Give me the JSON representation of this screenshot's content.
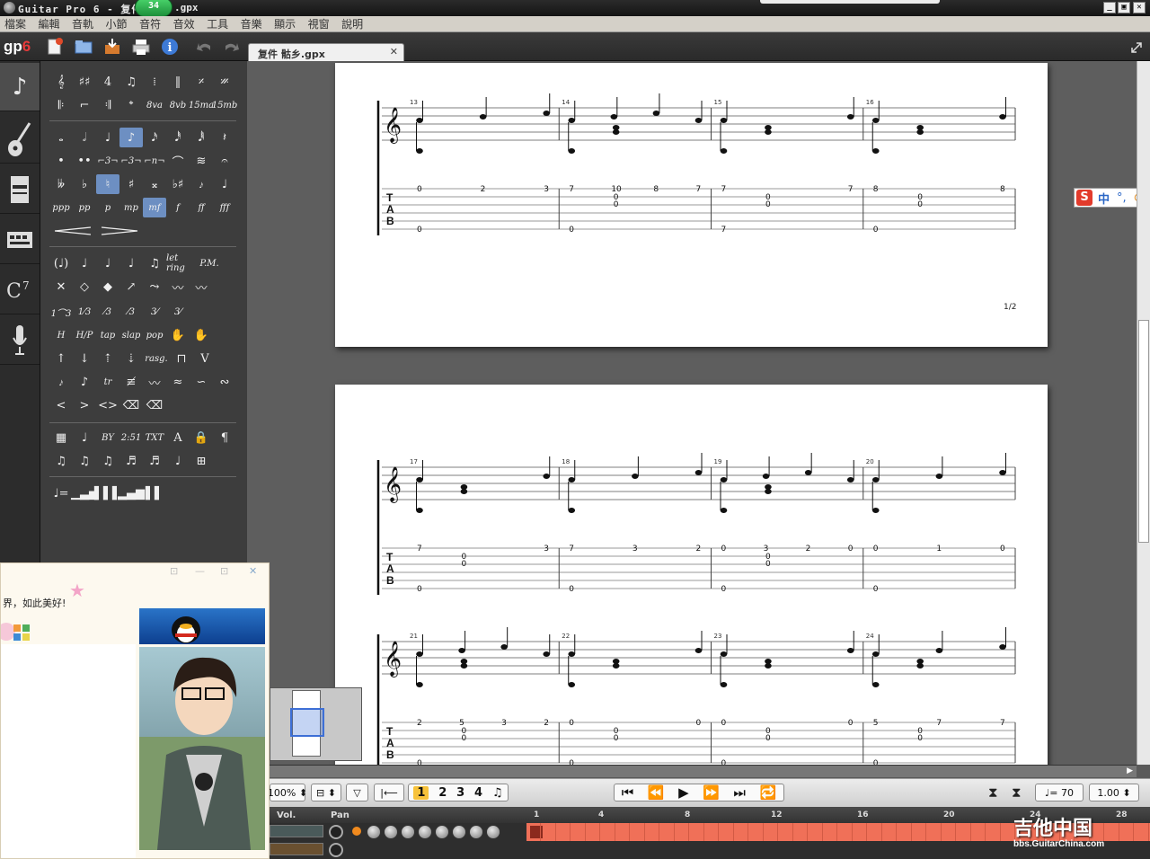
{
  "window": {
    "title_prefix": "Guitar Pro 6 - 复件",
    "title_suffix": ".gpx",
    "notification_badge": "34",
    "controls": [
      "_",
      "▣",
      "✕"
    ]
  },
  "menu": [
    "檔案",
    "編輯",
    "音軌",
    "小節",
    "音符",
    "音效",
    "工具",
    "音樂",
    "顯示",
    "視窗",
    "說明"
  ],
  "toolbar": {
    "logo_text": "gp",
    "logo_suffix": "6"
  },
  "document": {
    "tab_label": "复件 骷乡.gpx",
    "tab_close": "✕",
    "page_number": "1/2"
  },
  "score": {
    "systems": [
      {
        "bars": [
          {
            "num": "13",
            "tab_top": [
              "0",
              "2",
              "3"
            ],
            "tab_mid": [],
            "tab_bottom": [
              "0"
            ]
          },
          {
            "num": "14",
            "tab_top": [
              "7",
              "10",
              "8",
              "7"
            ],
            "tab_mid": [
              "0",
              "0"
            ],
            "tab_bottom": [
              "0"
            ]
          },
          {
            "num": "15",
            "tab_top": [
              "7",
              "7"
            ],
            "tab_mid": [
              "0",
              "0"
            ],
            "tab_bottom": [
              "7"
            ]
          },
          {
            "num": "16",
            "tab_top": [
              "8",
              "8"
            ],
            "tab_mid": [
              "0",
              "0"
            ],
            "tab_bottom": [
              "0"
            ]
          }
        ]
      },
      {
        "bars": [
          {
            "num": "17",
            "tab_top": [
              "7",
              "3"
            ],
            "tab_mid": [
              "0",
              "0"
            ],
            "tab_bottom": [
              "0"
            ]
          },
          {
            "num": "18",
            "tab_top": [
              "7",
              "3",
              "2"
            ],
            "tab_mid": [],
            "tab_bottom": [
              "0"
            ]
          },
          {
            "num": "19",
            "tab_top": [
              "0",
              "3",
              "2",
              "0"
            ],
            "tab_mid": [
              "0",
              "0"
            ],
            "tab_bottom": [
              "0"
            ]
          },
          {
            "num": "20",
            "tab_top": [
              "0",
              "1",
              "0"
            ],
            "tab_mid": [],
            "tab_bottom": [
              "0"
            ]
          }
        ]
      },
      {
        "bars": [
          {
            "num": "21",
            "tab_top": [
              "2",
              "5",
              "3",
              "2"
            ],
            "tab_mid": [
              "0",
              "0"
            ],
            "tab_bottom": [
              "0"
            ]
          },
          {
            "num": "22",
            "tab_top": [
              "0",
              "0"
            ],
            "tab_mid": [
              "0",
              "0"
            ],
            "tab_bottom": [
              "0"
            ]
          },
          {
            "num": "23",
            "tab_top": [
              "0",
              "0"
            ],
            "tab_mid": [
              "0",
              "0"
            ],
            "tab_bottom": [
              "0"
            ]
          },
          {
            "num": "24",
            "tab_top": [
              "5",
              "7",
              "7"
            ],
            "tab_mid": [
              "0",
              "0"
            ],
            "tab_bottom": [
              "0"
            ]
          }
        ]
      }
    ],
    "tab_letters": [
      "T",
      "A",
      "B"
    ]
  },
  "palette": {
    "dynamics": [
      "ppp",
      "pp",
      "p",
      "mp",
      "mf",
      "f",
      "ff",
      "fff"
    ],
    "text_markers": [
      "BY",
      "2:51",
      "TXT",
      "A"
    ],
    "special": [
      "8va",
      "8vb",
      "15ma",
      "15mb"
    ],
    "labels": [
      "let ring",
      "P.M.",
      "tap",
      "slap",
      "pop",
      "rasg."
    ]
  },
  "transport": {
    "zoom": "100%",
    "voices": [
      "1",
      "2",
      "3",
      "4"
    ],
    "tempo": "♩= 70",
    "speed": "1.00"
  },
  "tracks": {
    "vol_label": "Vol.",
    "pan_label": "Pan",
    "ruler": [
      "1",
      "4",
      "8",
      "12",
      "16",
      "20",
      "24",
      "28"
    ]
  },
  "chat": {
    "message": "界，如此美好!"
  },
  "watermark": {
    "title": "吉他中国",
    "url": "bbs.GuitarChina.com"
  },
  "ime": {
    "label": "中"
  },
  "colors": {
    "accent": "#6d8fc2",
    "timeline": "#f07058",
    "badge": "#2bb34f"
  }
}
